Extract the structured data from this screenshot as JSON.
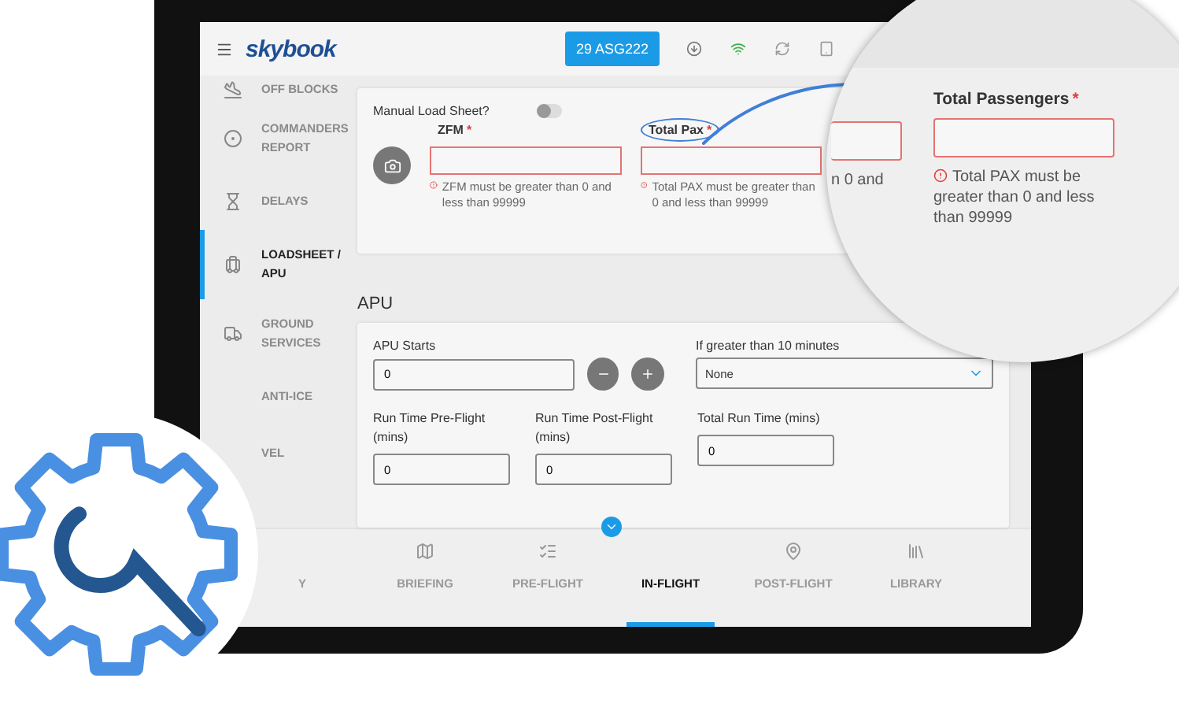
{
  "header": {
    "logo": "skybook",
    "flight": "29 ASG222"
  },
  "sidebar": {
    "items": [
      {
        "label": "OFF BLOCKS",
        "selected": false
      },
      {
        "label": "COMMANDERS REPORT",
        "selected": false
      },
      {
        "label": "DELAYS",
        "selected": false
      },
      {
        "label": "LOADSHEET / APU",
        "selected": true
      },
      {
        "label": "GROUND SERVICES",
        "selected": false
      },
      {
        "label": "ANTI-ICE",
        "selected": false
      },
      {
        "label": "VEL",
        "selected": false
      }
    ]
  },
  "loadsheet": {
    "manual_label": "Manual Load Sheet?",
    "manual_on": false,
    "fields": [
      {
        "label": "ZFM",
        "required_mark": "*",
        "error": "ZFM must be greater than 0 and less than 99999",
        "highlighted": false
      },
      {
        "label": "Total Pax",
        "required_mark": "*",
        "error": "Total PAX must be greater than 0 and less than 99999",
        "highlighted": true
      }
    ]
  },
  "magnifier": {
    "partial_error": "n 0 and",
    "field": {
      "label": "Total Passengers",
      "required_mark": "*",
      "error": "Total PAX must be greater than 0 and less than 99999"
    }
  },
  "apu": {
    "title": "APU",
    "starts": {
      "label": "APU Starts",
      "value": "0"
    },
    "select": {
      "label": "If greater than 10 minutes",
      "value": "None"
    },
    "times": [
      {
        "label": "Run Time Pre-Flight (mins)",
        "value": "0"
      },
      {
        "label": "Run Time Post-Flight (mins)",
        "value": "0"
      },
      {
        "label": "Total Run Time (mins)",
        "value": "0"
      }
    ]
  },
  "tabs": [
    {
      "label": "Y",
      "selected": false
    },
    {
      "label": "BRIEFING",
      "selected": false
    },
    {
      "label": "PRE-FLIGHT",
      "selected": false
    },
    {
      "label": "IN-FLIGHT",
      "selected": true
    },
    {
      "label": "POST-FLIGHT",
      "selected": false
    },
    {
      "label": "LIBRARY",
      "selected": false
    }
  ]
}
